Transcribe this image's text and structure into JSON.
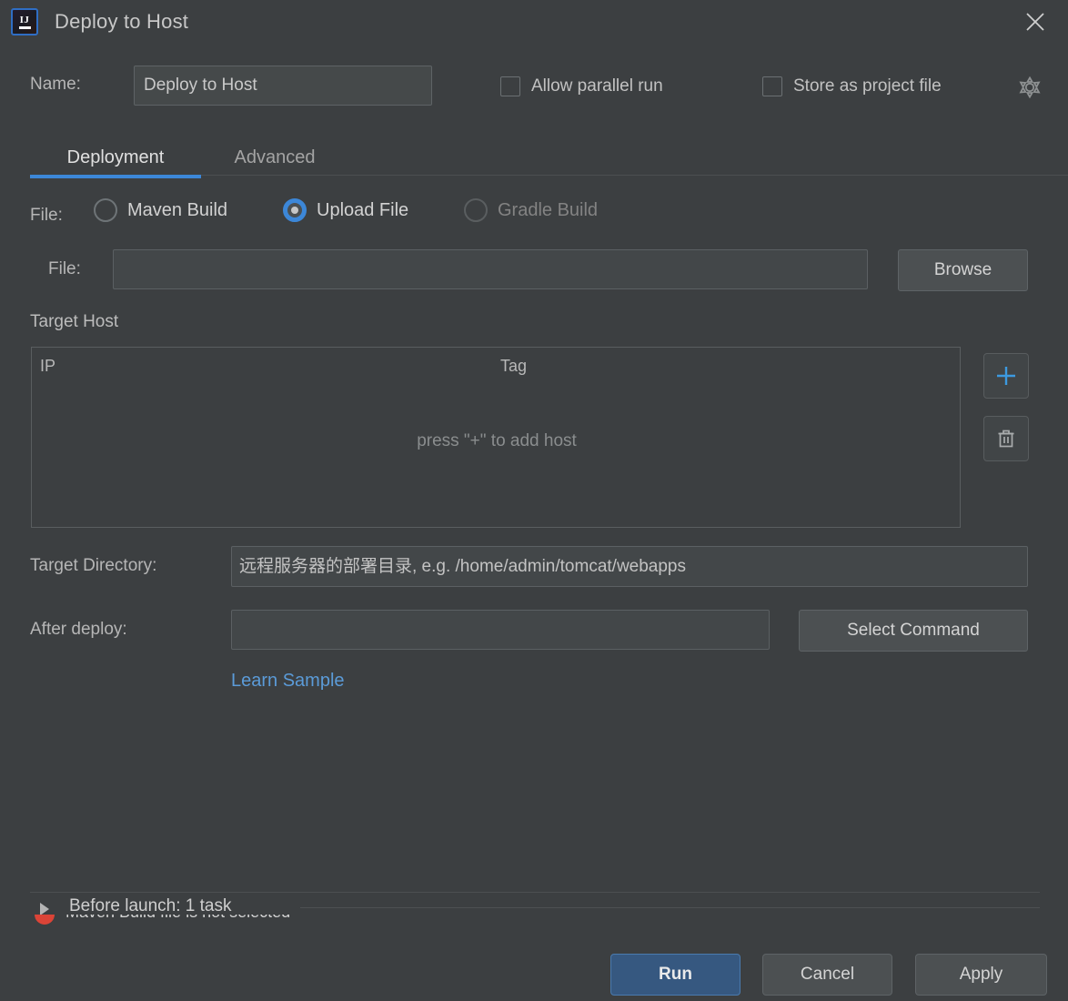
{
  "window": {
    "title": "Deploy to Host",
    "app_icon": "intellij-idea-icon",
    "close_icon": "close-icon"
  },
  "name_row": {
    "label": "Name:",
    "value": "Deploy to Host",
    "allow_parallel_run": {
      "label": "Allow parallel run",
      "checked": false
    },
    "store_as_project_file": {
      "label": "Store as project file",
      "checked": false
    },
    "gear_icon": "gear-icon"
  },
  "tabs": [
    {
      "label": "Deployment",
      "selected": true
    },
    {
      "label": "Advanced",
      "selected": false
    }
  ],
  "file_kind": {
    "label": "File:",
    "options": [
      {
        "label": "Maven Build",
        "selected": false,
        "disabled": false
      },
      {
        "label": "Upload File",
        "selected": true,
        "disabled": false
      },
      {
        "label": "Gradle Build",
        "selected": false,
        "disabled": true
      }
    ]
  },
  "file_picker": {
    "label": "File:",
    "value": "",
    "placeholder": "",
    "browse_label": "Browse"
  },
  "target_host": {
    "section_label": "Target Host",
    "columns": [
      "IP",
      "Tag"
    ],
    "rows": [],
    "empty_text": "press \"+\" to add host",
    "add_icon": "plus-icon",
    "remove_icon": "trash-icon"
  },
  "target_directory": {
    "label": "Target Directory:",
    "value": "",
    "placeholder": "远程服务器的部署目录, e.g. /home/admin/tomcat/webapps"
  },
  "after_deploy": {
    "label": "After deploy:",
    "value": "",
    "placeholder": "",
    "select_command_label": "Select Command",
    "learn_sample_label": "Learn Sample"
  },
  "before_launch": {
    "title": "Before launch: 1 task",
    "expanded": false,
    "arrow_icon": "chevron-right-icon"
  },
  "error": {
    "icon": "error-icon",
    "message": "Maven Build file is not selected"
  },
  "footer": {
    "run_label": "Run",
    "cancel_label": "Cancel",
    "apply_label": "Apply"
  },
  "colors": {
    "background": "#3c3f41",
    "accent_blue": "#3c87d8",
    "link_blue": "#5b9bd8",
    "primary_button": "#365880",
    "error_red": "#db4437",
    "field_background": "#434749",
    "border": "#5b6063"
  }
}
